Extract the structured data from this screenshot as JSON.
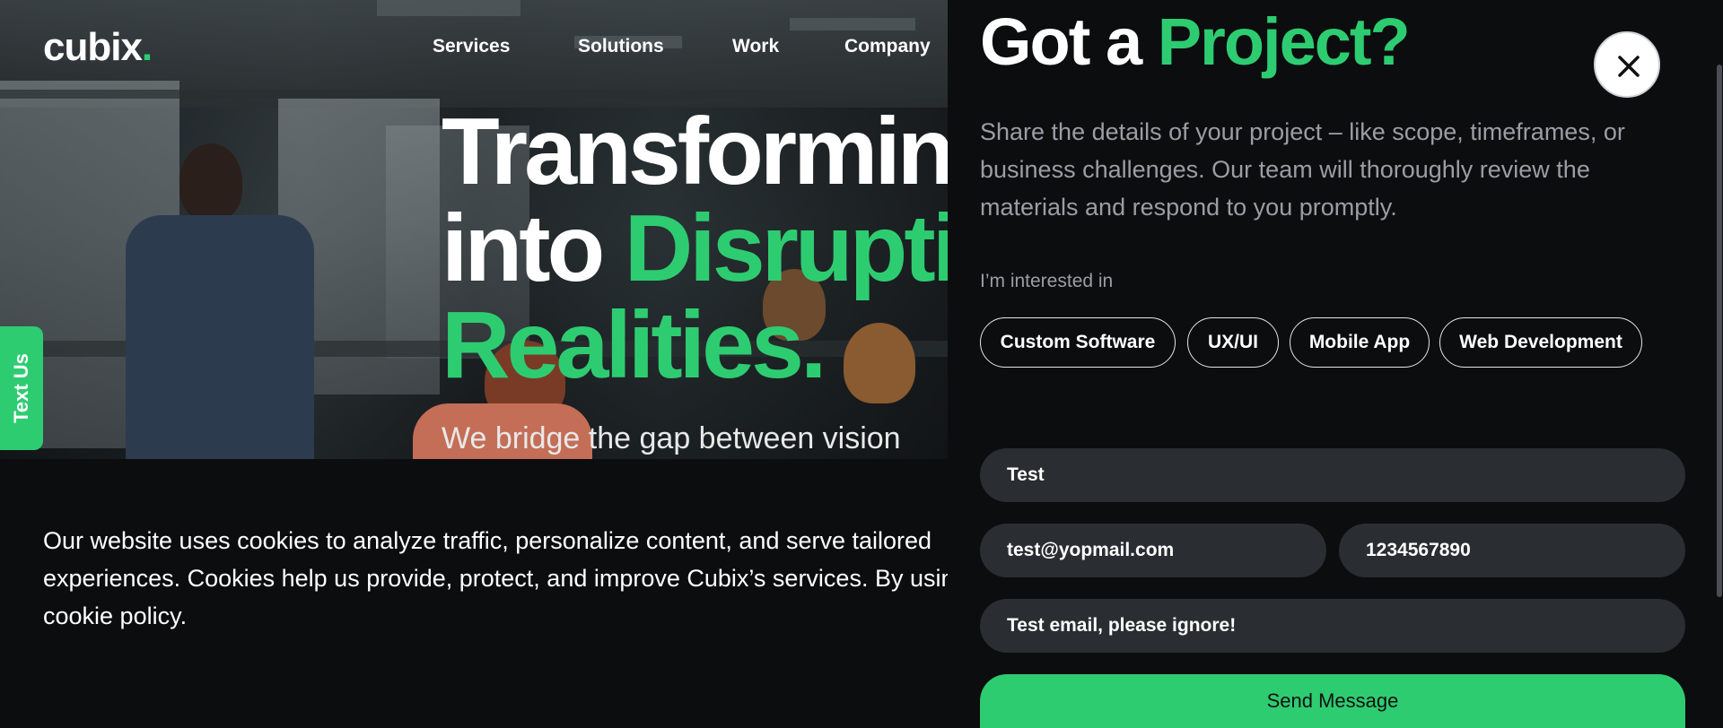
{
  "logo": {
    "text": "cubix",
    "dot": "."
  },
  "nav": {
    "items": [
      {
        "label": "Services"
      },
      {
        "label": "Solutions"
      },
      {
        "label": "Work"
      },
      {
        "label": "Company"
      }
    ]
  },
  "hero": {
    "line1": "Transforming",
    "line2_white": "into ",
    "line2_green": "Disruptive",
    "line3": "Realities.",
    "subtitle": "We bridge the gap between vision"
  },
  "text_us": {
    "label": "Text Us"
  },
  "cookie": {
    "text": "Our website uses cookies to analyze traffic, personalize content, and serve tailored experiences. Cookies help us provide, protect, and improve Cubix’s services. By using our cookie policy."
  },
  "drawer": {
    "title_white": "Got a ",
    "title_green": "Project?",
    "description": "Share the details of your project – like scope, timeframes, or business challenges. Our team will thoroughly review the materials and respond to you promptly.",
    "interest_label": "I’m interested in",
    "chips": [
      {
        "label": "Custom Software"
      },
      {
        "label": "UX/UI"
      },
      {
        "label": "Mobile App"
      },
      {
        "label": "Web Development"
      }
    ],
    "form": {
      "name": "Test",
      "email": "test@yopmail.com",
      "phone": "1234567890",
      "message": "Test email, please ignore!",
      "send_label": "Send Message"
    },
    "close_icon": "close-icon"
  },
  "colors": {
    "accent": "#2ecc71",
    "background": "#0c0d0f",
    "field_bg": "#2a2d31",
    "muted_text": "#9a9ea4"
  }
}
